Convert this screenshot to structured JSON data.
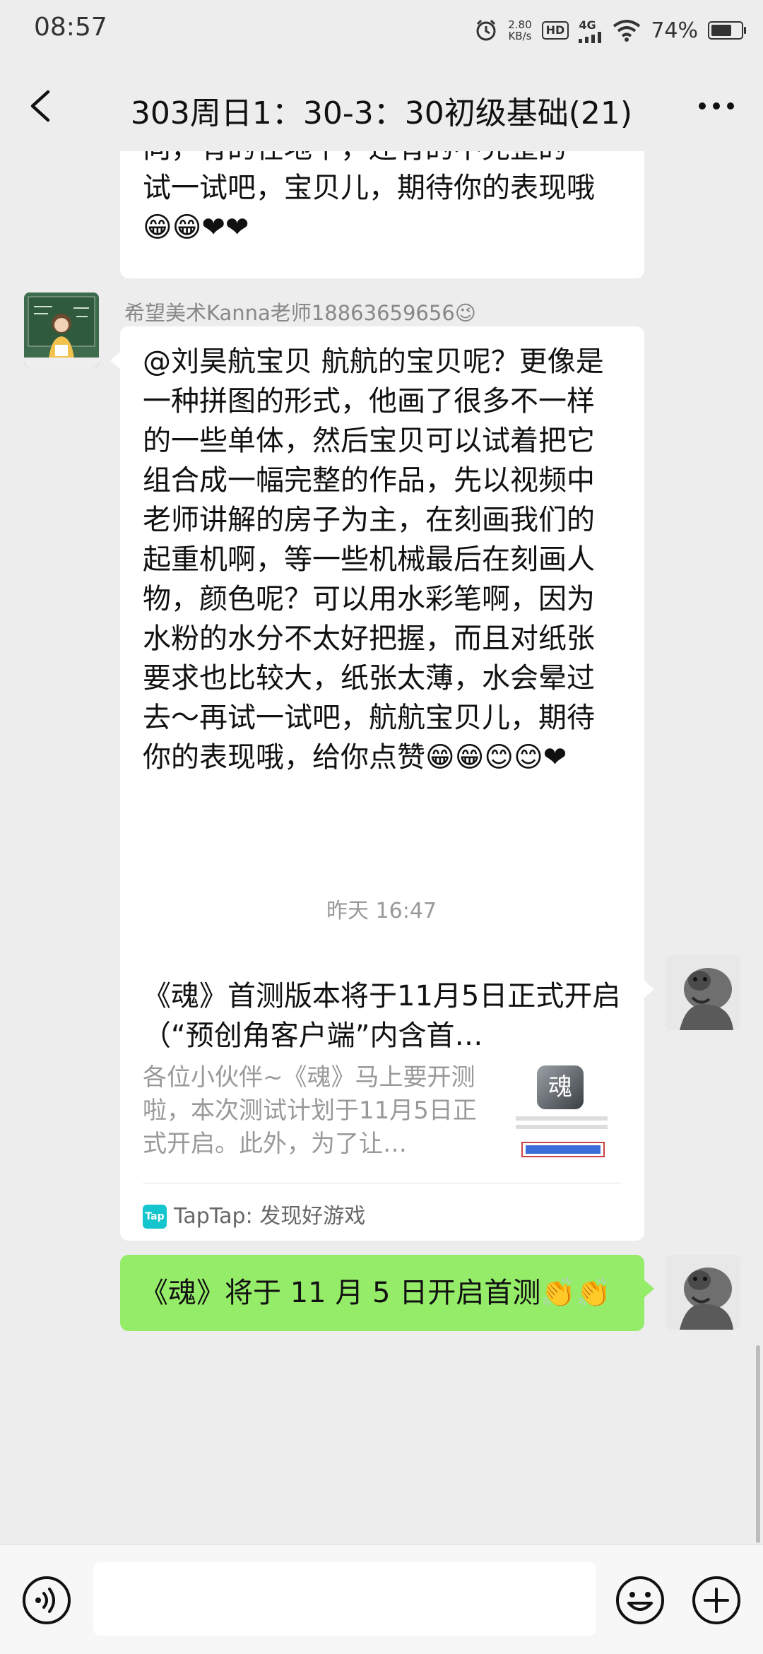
{
  "status_bar": {
    "time": "08:57",
    "speed": "2.80",
    "speed_unit": "KB/s",
    "hd": "HD",
    "network": "4G",
    "battery": "74%",
    "battery_level": 0.74
  },
  "header": {
    "title": "303周日1：30-3：30初级基础(21)"
  },
  "messages": {
    "partial_top_text": "向，有的在地下，还有的不完整的～试一试吧，宝贝儿，期待你的表现哦😁😁❤❤",
    "teacher_name": "希望美术Kanna老师18863659656😉",
    "teacher_text": "@刘昊航宝贝  航航的宝贝呢？更像是一种拼图的形式，他画了很多不一样的一些单体，然后宝贝可以试着把它组合成一幅完整的作品，先以视频中老师讲解的房子为主，在刻画我们的起重机啊，等一些机械最后在刻画人物，颜色呢？可以用水彩笔啊，因为水粉的水分不太好把握，而且对纸张要求也比较大，纸张太薄，水会晕过去～再试一试吧，航航宝贝儿，期待你的表现哦，给你点赞😁😁😊😊❤",
    "timestamp": "昨天 16:47",
    "link_card": {
      "title": "《魂》首测版本将于11月5日正式开启（“预创角客户端”内含首…",
      "description": "各位小伙伴~《魂》马上要开测啦，本次测试计划于11月5日正式开启。此外，为了让…",
      "thumb_glyph": "魂",
      "source_icon": "Tap",
      "source": "TapTap: 发现好游戏"
    },
    "sent_text": "《魂》将于 11 月 5 日开启首测👏👏"
  },
  "input": {
    "placeholder": ""
  },
  "icons": {
    "back": "chevron-left-icon",
    "more": "more-dots-icon",
    "voice": "voice-icon",
    "emoji": "emoji-icon",
    "plus": "plus-icon"
  },
  "colors": {
    "background": "#ededed",
    "bubble_sent": "#95ec69",
    "bubble_received": "#ffffff",
    "taptap": "#15c5ce"
  }
}
